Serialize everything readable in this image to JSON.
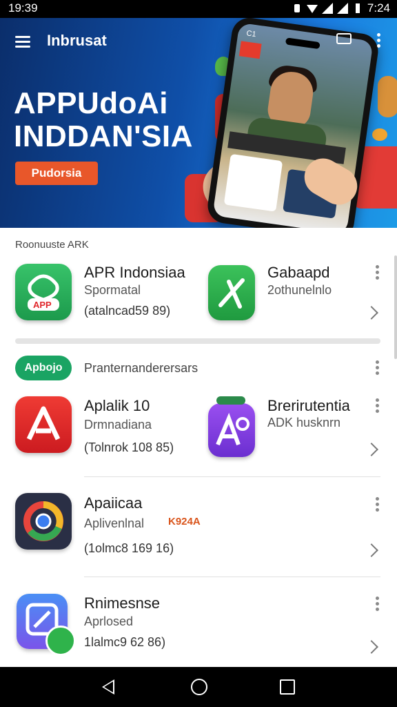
{
  "status_bar": {
    "time_left": "19:39",
    "time_right": "7:24"
  },
  "hero": {
    "app_title": "Inbrusat",
    "big_title_line1": "APPUdoAi",
    "big_title_line2": "INDDAN'SIA",
    "button_label": "Pudorsia",
    "phone_corner_label": "C1"
  },
  "section_label": "Roonuuste   ARK",
  "apps_top": [
    {
      "name": "APR Indonsiaa",
      "sub": "Spormatal",
      "meta": "(atalncad59 89)",
      "icon_badge": "APP"
    },
    {
      "name": "Gabaapd",
      "sub": "2othunelnlo"
    }
  ],
  "promo": {
    "pill_label": "Apbojo",
    "label": "Pranternanderersars"
  },
  "apps_mid": [
    {
      "name": "Aplalik 10",
      "sub": "Drmnadiana",
      "meta": "(Tolnrok 108 85)"
    },
    {
      "name": "Brerirutentia",
      "sub": "ADK husknrn"
    }
  ],
  "apps_bottom": [
    {
      "name": "Apaiicaa",
      "sub": "Aplivenlnal",
      "meta": "(1olmc8 169 16)",
      "tag": "K924A"
    },
    {
      "name": "Rnimesnse",
      "sub": "Aprlosed",
      "meta": "1lalmc9 62 86)"
    }
  ],
  "colors": {
    "hero_dark": "#0b2e6b",
    "hero_light": "#1c9be6",
    "button_orange": "#e8572a",
    "pill_green": "#1aa463",
    "app_green": "#2bb24c",
    "app_red": "#e0262a",
    "app_purple": "#7b3fe0",
    "app_dark": "#2a2f45",
    "app_blue": "#3b7df0"
  },
  "icons": {
    "menu": "menu-icon",
    "overflow": "more-vert-icon",
    "chevron": "chevron-right-icon",
    "back": "back-icon",
    "home": "home-icon",
    "recents": "recents-icon"
  }
}
